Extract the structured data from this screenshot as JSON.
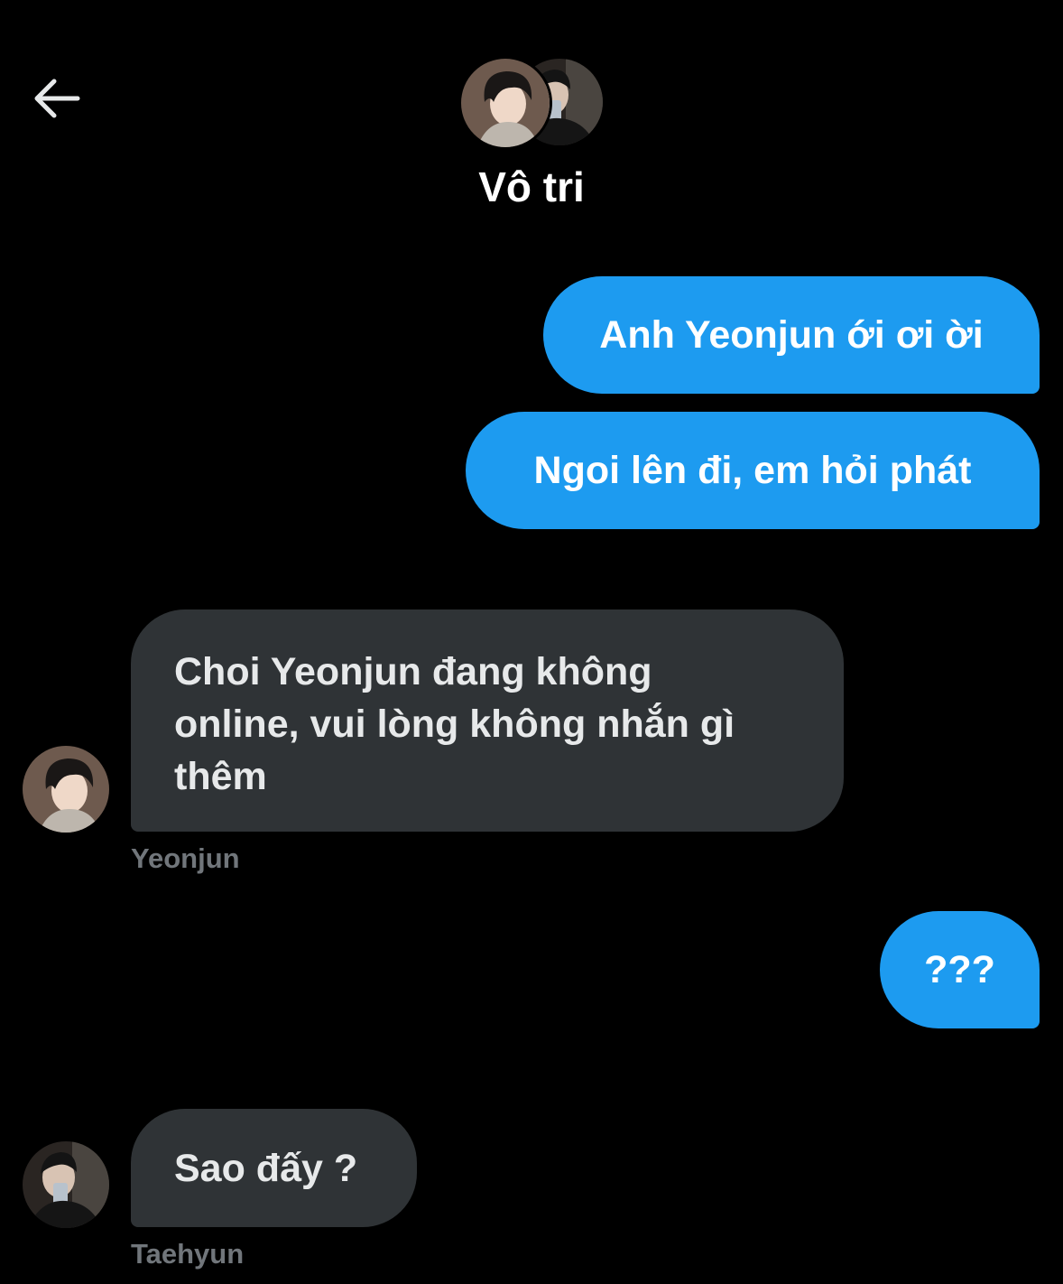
{
  "header": {
    "back_icon": "arrow-left-icon",
    "title": "Vô tri"
  },
  "colors": {
    "background": "#000000",
    "outgoing_bubble": "#1d9bf0",
    "incoming_bubble": "#2f3336",
    "sender_text": "#71767b"
  },
  "messages": [
    {
      "direction": "outgoing",
      "text": "Anh Yeonjun ới ơi ời"
    },
    {
      "direction": "outgoing",
      "text": "Ngoi lên đi, em hỏi phát"
    },
    {
      "direction": "incoming",
      "lines": [
        "Choi Yeonjun đang không",
        "online, vui lòng không nhắn gì",
        "thêm"
      ],
      "sender": "Yeonjun"
    },
    {
      "direction": "outgoing",
      "text": "???"
    },
    {
      "direction": "incoming",
      "text": "Sao đấy ?",
      "sender": "Taehyun"
    }
  ]
}
